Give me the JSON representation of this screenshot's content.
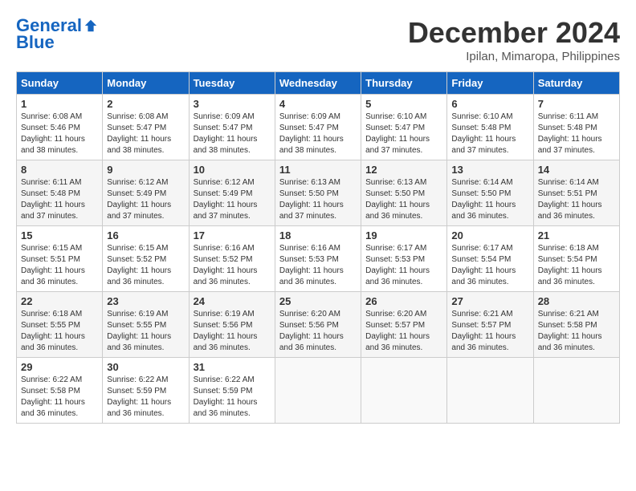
{
  "header": {
    "logo_line1": "General",
    "logo_line2": "Blue",
    "month": "December 2024",
    "location": "Ipilan, Mimaropa, Philippines"
  },
  "weekdays": [
    "Sunday",
    "Monday",
    "Tuesday",
    "Wednesday",
    "Thursday",
    "Friday",
    "Saturday"
  ],
  "weeks": [
    [
      {
        "day": "1",
        "info": "Sunrise: 6:08 AM\nSunset: 5:46 PM\nDaylight: 11 hours\nand 38 minutes."
      },
      {
        "day": "2",
        "info": "Sunrise: 6:08 AM\nSunset: 5:47 PM\nDaylight: 11 hours\nand 38 minutes."
      },
      {
        "day": "3",
        "info": "Sunrise: 6:09 AM\nSunset: 5:47 PM\nDaylight: 11 hours\nand 38 minutes."
      },
      {
        "day": "4",
        "info": "Sunrise: 6:09 AM\nSunset: 5:47 PM\nDaylight: 11 hours\nand 38 minutes."
      },
      {
        "day": "5",
        "info": "Sunrise: 6:10 AM\nSunset: 5:47 PM\nDaylight: 11 hours\nand 37 minutes."
      },
      {
        "day": "6",
        "info": "Sunrise: 6:10 AM\nSunset: 5:48 PM\nDaylight: 11 hours\nand 37 minutes."
      },
      {
        "day": "7",
        "info": "Sunrise: 6:11 AM\nSunset: 5:48 PM\nDaylight: 11 hours\nand 37 minutes."
      }
    ],
    [
      {
        "day": "8",
        "info": "Sunrise: 6:11 AM\nSunset: 5:48 PM\nDaylight: 11 hours\nand 37 minutes."
      },
      {
        "day": "9",
        "info": "Sunrise: 6:12 AM\nSunset: 5:49 PM\nDaylight: 11 hours\nand 37 minutes."
      },
      {
        "day": "10",
        "info": "Sunrise: 6:12 AM\nSunset: 5:49 PM\nDaylight: 11 hours\nand 37 minutes."
      },
      {
        "day": "11",
        "info": "Sunrise: 6:13 AM\nSunset: 5:50 PM\nDaylight: 11 hours\nand 37 minutes."
      },
      {
        "day": "12",
        "info": "Sunrise: 6:13 AM\nSunset: 5:50 PM\nDaylight: 11 hours\nand 36 minutes."
      },
      {
        "day": "13",
        "info": "Sunrise: 6:14 AM\nSunset: 5:50 PM\nDaylight: 11 hours\nand 36 minutes."
      },
      {
        "day": "14",
        "info": "Sunrise: 6:14 AM\nSunset: 5:51 PM\nDaylight: 11 hours\nand 36 minutes."
      }
    ],
    [
      {
        "day": "15",
        "info": "Sunrise: 6:15 AM\nSunset: 5:51 PM\nDaylight: 11 hours\nand 36 minutes."
      },
      {
        "day": "16",
        "info": "Sunrise: 6:15 AM\nSunset: 5:52 PM\nDaylight: 11 hours\nand 36 minutes."
      },
      {
        "day": "17",
        "info": "Sunrise: 6:16 AM\nSunset: 5:52 PM\nDaylight: 11 hours\nand 36 minutes."
      },
      {
        "day": "18",
        "info": "Sunrise: 6:16 AM\nSunset: 5:53 PM\nDaylight: 11 hours\nand 36 minutes."
      },
      {
        "day": "19",
        "info": "Sunrise: 6:17 AM\nSunset: 5:53 PM\nDaylight: 11 hours\nand 36 minutes."
      },
      {
        "day": "20",
        "info": "Sunrise: 6:17 AM\nSunset: 5:54 PM\nDaylight: 11 hours\nand 36 minutes."
      },
      {
        "day": "21",
        "info": "Sunrise: 6:18 AM\nSunset: 5:54 PM\nDaylight: 11 hours\nand 36 minutes."
      }
    ],
    [
      {
        "day": "22",
        "info": "Sunrise: 6:18 AM\nSunset: 5:55 PM\nDaylight: 11 hours\nand 36 minutes."
      },
      {
        "day": "23",
        "info": "Sunrise: 6:19 AM\nSunset: 5:55 PM\nDaylight: 11 hours\nand 36 minutes."
      },
      {
        "day": "24",
        "info": "Sunrise: 6:19 AM\nSunset: 5:56 PM\nDaylight: 11 hours\nand 36 minutes."
      },
      {
        "day": "25",
        "info": "Sunrise: 6:20 AM\nSunset: 5:56 PM\nDaylight: 11 hours\nand 36 minutes."
      },
      {
        "day": "26",
        "info": "Sunrise: 6:20 AM\nSunset: 5:57 PM\nDaylight: 11 hours\nand 36 minutes."
      },
      {
        "day": "27",
        "info": "Sunrise: 6:21 AM\nSunset: 5:57 PM\nDaylight: 11 hours\nand 36 minutes."
      },
      {
        "day": "28",
        "info": "Sunrise: 6:21 AM\nSunset: 5:58 PM\nDaylight: 11 hours\nand 36 minutes."
      }
    ],
    [
      {
        "day": "29",
        "info": "Sunrise: 6:22 AM\nSunset: 5:58 PM\nDaylight: 11 hours\nand 36 minutes."
      },
      {
        "day": "30",
        "info": "Sunrise: 6:22 AM\nSunset: 5:59 PM\nDaylight: 11 hours\nand 36 minutes."
      },
      {
        "day": "31",
        "info": "Sunrise: 6:22 AM\nSunset: 5:59 PM\nDaylight: 11 hours\nand 36 minutes."
      },
      {
        "day": "",
        "info": ""
      },
      {
        "day": "",
        "info": ""
      },
      {
        "day": "",
        "info": ""
      },
      {
        "day": "",
        "info": ""
      }
    ]
  ]
}
